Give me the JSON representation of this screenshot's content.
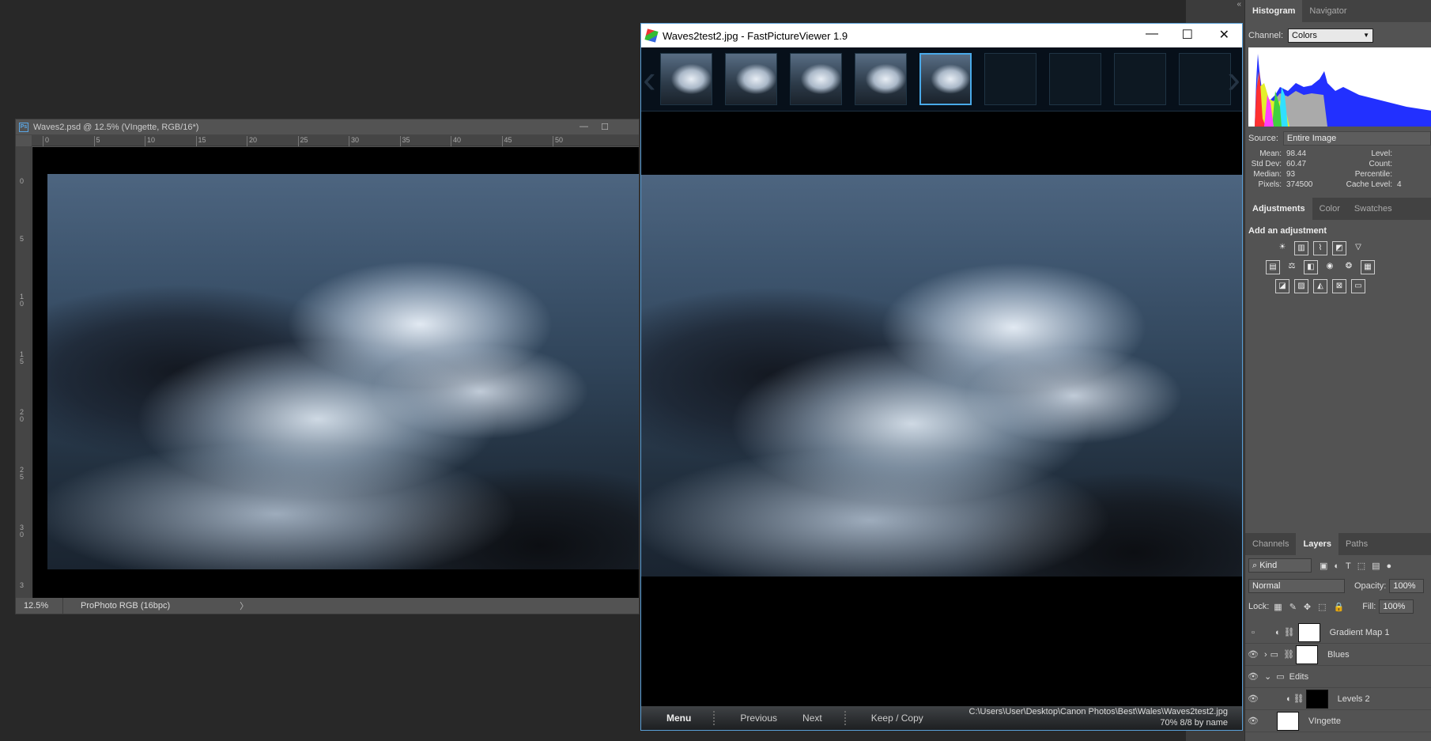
{
  "photoshop": {
    "doc_title": "Waves2.psd @ 12.5% (VIngette, RGB/16*)",
    "ruler_top": [
      "0",
      "5",
      "10",
      "15",
      "20",
      "25",
      "30",
      "35",
      "40",
      "45",
      "50"
    ],
    "ruler_left": [
      "0",
      "5",
      "10",
      "15",
      "20",
      "25",
      "30",
      "3"
    ],
    "zoom": "12.5%",
    "profile": "ProPhoto RGB (16bpc)",
    "status_arrow": "〉"
  },
  "fpv": {
    "title": "Waves2test2.jpg - FastPictureViewer 1.9",
    "thumbs_filled": 5,
    "thumbs_empty": 4,
    "selected_index": 5,
    "buttons": {
      "menu": "Menu",
      "previous": "Previous",
      "next": "Next",
      "keep_copy": "Keep / Copy"
    },
    "path": "C:\\Users\\User\\Desktop\\Canon Photos\\Best\\Wales\\Waves2test2.jpg",
    "status": "70%  8/8  by name"
  },
  "histogram": {
    "tabs": [
      "Histogram",
      "Navigator"
    ],
    "channel_label": "Channel:",
    "channel_value": "Colors",
    "source_label": "Source:",
    "source_value": "Entire Image",
    "stats": [
      {
        "label": "Mean:",
        "value": "98.44",
        "label2": "Level:",
        "value2": ""
      },
      {
        "label": "Std Dev:",
        "value": "60.47",
        "label2": "Count:",
        "value2": ""
      },
      {
        "label": "Median:",
        "value": "93",
        "label2": "Percentile:",
        "value2": ""
      },
      {
        "label": "Pixels:",
        "value": "374500",
        "label2": "Cache Level:",
        "value2": "4"
      }
    ]
  },
  "adjustments": {
    "tabs": [
      "Adjustments",
      "Color",
      "Swatches"
    ],
    "title": "Add an adjustment"
  },
  "layers": {
    "tabs": [
      "Channels",
      "Layers",
      "Paths"
    ],
    "kind": "Kind",
    "blend_mode": "Normal",
    "opacity_label": "Opacity:",
    "opacity": "100%",
    "lock_label": "Lock:",
    "fill_label": "Fill:",
    "fill": "100%",
    "items": [
      {
        "name": "Gradient Map 1",
        "visible": false
      },
      {
        "name": "Blues",
        "visible": true
      },
      {
        "name": "Edits",
        "visible": true
      },
      {
        "name": "Levels 2",
        "visible": true
      },
      {
        "name": "VIngette",
        "visible": true
      }
    ]
  },
  "colors": {
    "accent": "#49a9e8",
    "panel_bg": "#535353",
    "app_bg": "#282828"
  }
}
